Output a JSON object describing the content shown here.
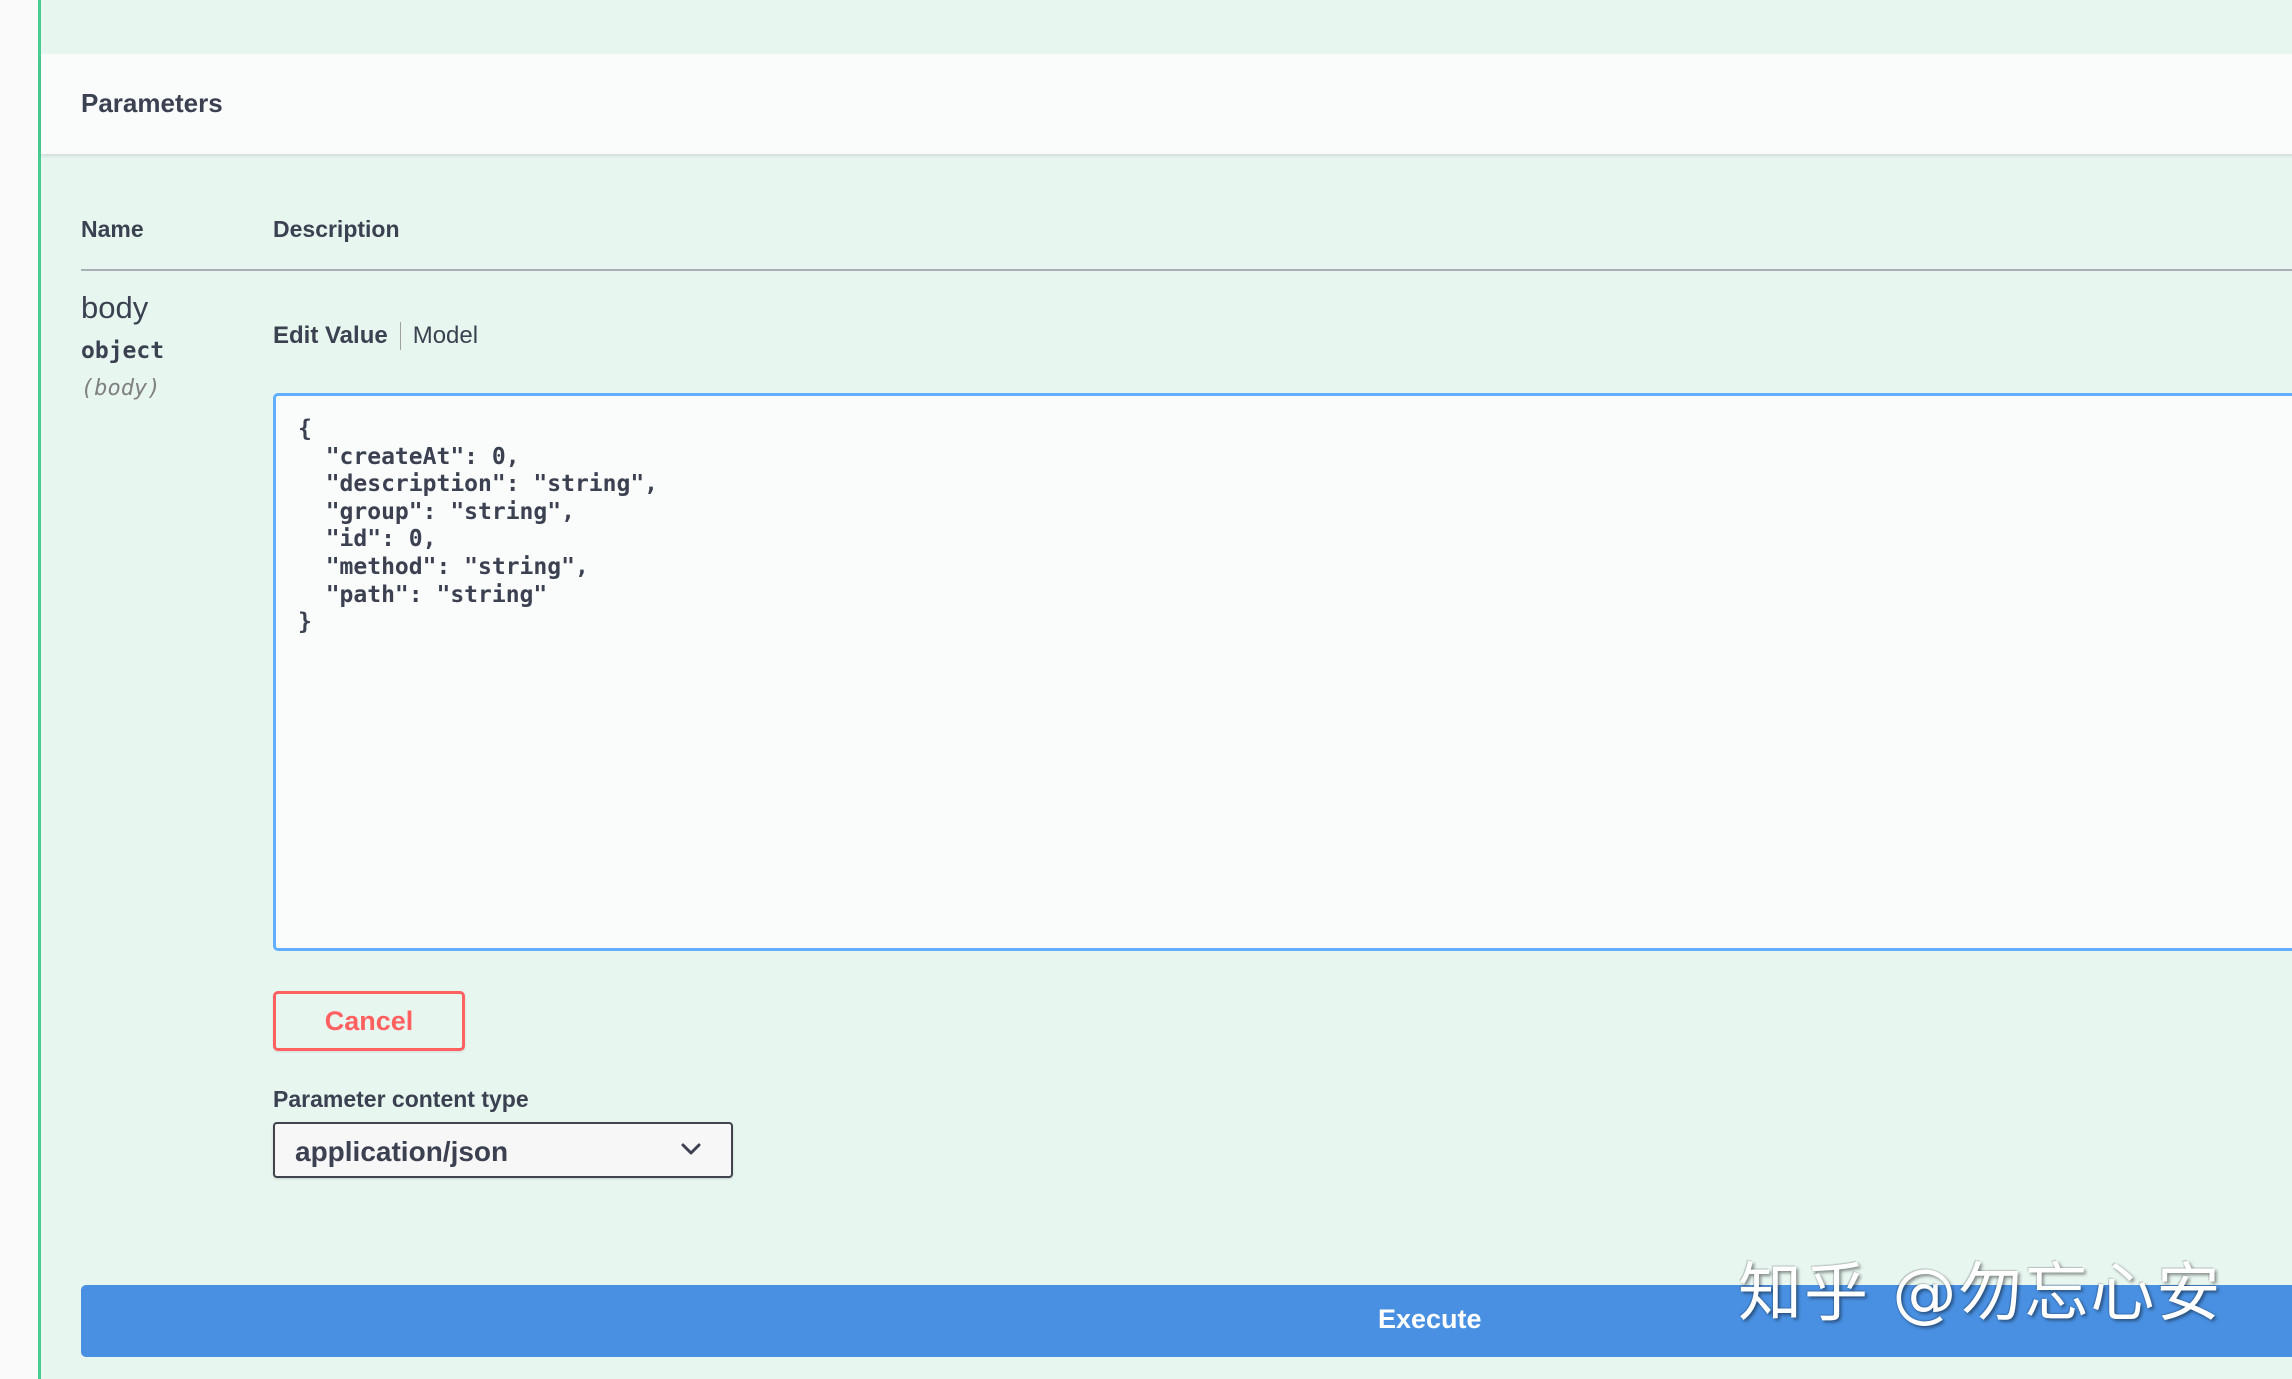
{
  "section": {
    "title": "Parameters"
  },
  "table": {
    "headers": {
      "name": "Name",
      "description": "Description"
    }
  },
  "parameter": {
    "name": "body",
    "type": "object",
    "location": "(body)"
  },
  "tabs": {
    "edit_value": "Edit Value",
    "model": "Model"
  },
  "editor": {
    "value": "{\n  \"createAt\": 0,\n  \"description\": \"string\",\n  \"group\": \"string\",\n  \"id\": 0,\n  \"method\": \"string\",\n  \"path\": \"string\"\n}"
  },
  "buttons": {
    "cancel": "Cancel",
    "execute": "Execute"
  },
  "content_type": {
    "label": "Parameter content type",
    "selected": "application/json"
  },
  "watermark": {
    "text": "知乎 @勿忘心安"
  },
  "icons": {
    "select_chevron": "chevron-down-icon"
  },
  "colors": {
    "block_background": "#e8f6f0",
    "accent_green": "#49cc90",
    "editor_border": "#61affe",
    "cancel_red": "#ff6060",
    "execute_blue": "#4990e2",
    "text": "#3b4151"
  }
}
